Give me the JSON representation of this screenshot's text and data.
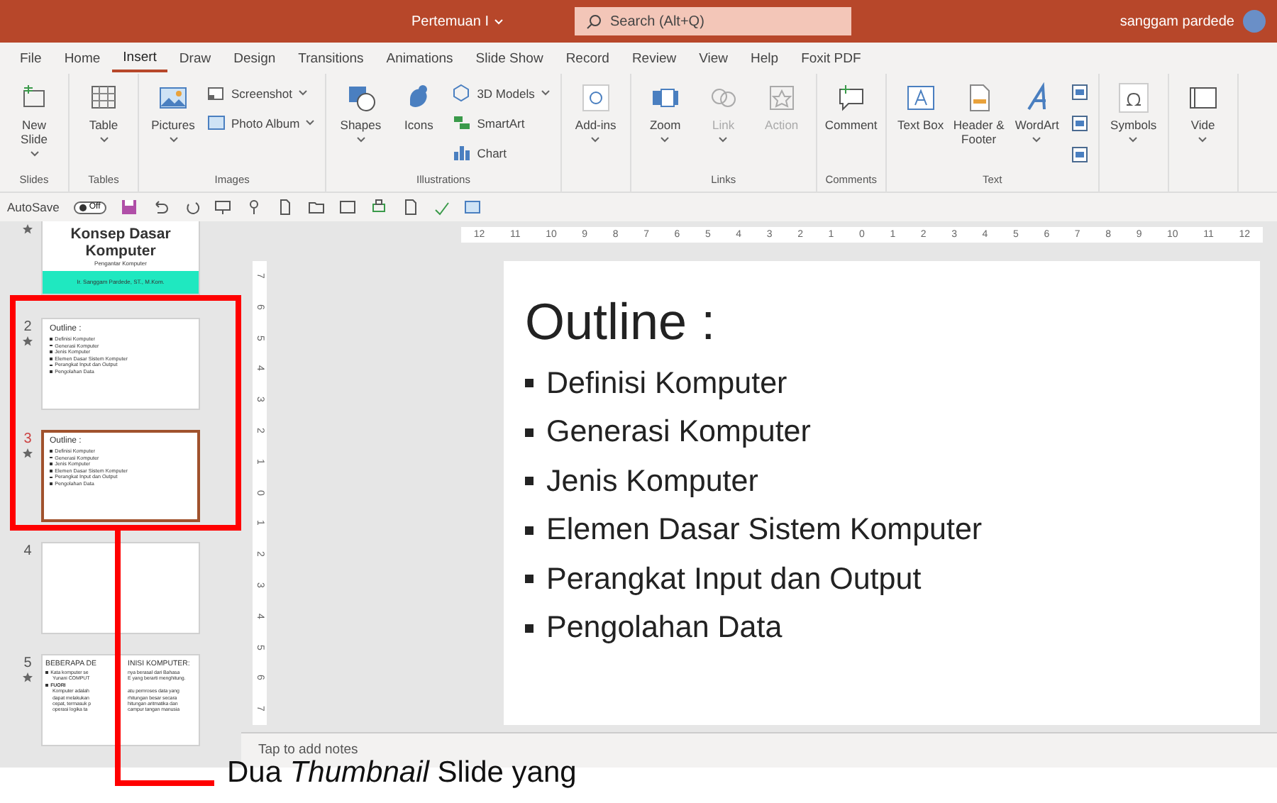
{
  "title_bar": {
    "document_title": "Pertemuan I",
    "search": {
      "placeholder": "Search (Alt+Q)"
    },
    "user": "sanggam pardede"
  },
  "menu_tabs": [
    {
      "label": "File",
      "selected": false
    },
    {
      "label": "Home",
      "selected": false
    },
    {
      "label": "Insert",
      "selected": true
    },
    {
      "label": "Draw",
      "selected": false
    },
    {
      "label": "Design",
      "selected": false
    },
    {
      "label": "Transitions",
      "selected": false
    },
    {
      "label": "Animations",
      "selected": false
    },
    {
      "label": "Slide Show",
      "selected": false
    },
    {
      "label": "Record",
      "selected": false
    },
    {
      "label": "Review",
      "selected": false
    },
    {
      "label": "View",
      "selected": false
    },
    {
      "label": "Help",
      "selected": false
    },
    {
      "label": "Foxit PDF",
      "selected": false
    }
  ],
  "ribbon": {
    "groups": [
      {
        "label": "Slides",
        "items": [
          {
            "kind": "large",
            "label": "New Slide",
            "dropdown": true,
            "disabled": false
          }
        ]
      },
      {
        "label": "Tables",
        "items": [
          {
            "kind": "large",
            "label": "Table",
            "dropdown": true,
            "disabled": false
          }
        ]
      },
      {
        "label": "Images",
        "items": [
          {
            "kind": "large",
            "label": "Pictures",
            "dropdown": true,
            "disabled": false
          },
          {
            "kind": "small",
            "label": "Screenshot",
            "dropdown": true,
            "disabled": false
          },
          {
            "kind": "small",
            "label": "Photo Album",
            "dropdown": true,
            "disabled": false
          }
        ]
      },
      {
        "label": "Illustrations",
        "items": [
          {
            "kind": "large",
            "label": "Shapes",
            "dropdown": true,
            "disabled": false
          },
          {
            "kind": "large",
            "label": "Icons",
            "dropdown": false,
            "disabled": false
          },
          {
            "kind": "small",
            "label": "3D Models",
            "dropdown": true,
            "disabled": false
          },
          {
            "kind": "small",
            "label": "SmartArt",
            "dropdown": false,
            "disabled": false
          },
          {
            "kind": "small",
            "label": "Chart",
            "dropdown": false,
            "disabled": false
          }
        ]
      },
      {
        "items": [
          {
            "kind": "large",
            "label": "Add-ins",
            "dropdown": true,
            "disabled": false
          }
        ]
      },
      {
        "label": "Links",
        "items": [
          {
            "kind": "large",
            "label": "Zoom",
            "dropdown": true,
            "disabled": false
          },
          {
            "kind": "large",
            "label": "Link",
            "dropdown": true,
            "disabled": true
          },
          {
            "kind": "large",
            "label": "Action",
            "dropdown": false,
            "disabled": true
          }
        ]
      },
      {
        "label": "Comments",
        "items": [
          {
            "kind": "large",
            "label": "Comment",
            "dropdown": false,
            "disabled": false
          }
        ]
      },
      {
        "label": "Text",
        "items": [
          {
            "kind": "large",
            "label": "Text Box",
            "dropdown": false,
            "disabled": false
          },
          {
            "kind": "large",
            "label": "Header & Footer",
            "dropdown": false,
            "disabled": false
          },
          {
            "kind": "large",
            "label": "WordArt",
            "dropdown": true,
            "disabled": false
          },
          {
            "kind": "icons",
            "dropdown": false,
            "disabled": false
          }
        ]
      },
      {
        "items": [
          {
            "kind": "large",
            "label": "Symbols",
            "dropdown": true,
            "disabled": false
          }
        ]
      },
      {
        "items": [
          {
            "kind": "large",
            "label": "Vide",
            "dropdown": true,
            "disabled": false
          }
        ]
      }
    ]
  },
  "quick_access": {
    "autosave_label": "AutoSave",
    "autosave": {
      "on": false,
      "label": "Off"
    }
  },
  "thumbnails": [
    {
      "kind": "title",
      "starred": true,
      "selected": false,
      "title": "Konsep Dasar Komputer",
      "subtitle": "Pengantar Komputer",
      "author": "Ir. Sanggam Pardede, ST., M.Kom."
    },
    {
      "number": "2",
      "kind": "outline",
      "starred": true,
      "selected": false,
      "title": "Outline :",
      "bullets": [
        "Definisi Komputer",
        "Generasi Komputer",
        "Jenis Komputer",
        "Elemen Dasar Sistem Komputer",
        "Perangkat Input dan Output",
        "Pengolahan Data"
      ]
    },
    {
      "number": "3",
      "kind": "outline",
      "starred": true,
      "selected": true,
      "title": "Outline :",
      "bullets": [
        "Definisi Komputer",
        "Generasi Komputer",
        "Jenis Komputer",
        "Elemen Dasar Sistem Komputer",
        "Perangkat Input dan Output",
        "Pengolahan Data"
      ]
    },
    {
      "number": "4",
      "kind": "blank",
      "starred": false,
      "selected": false
    },
    {
      "number": "5",
      "kind": "split",
      "starred": true,
      "selected": false,
      "title": [
        "BEBERAPA DE",
        "INISI KOMPUTER:"
      ],
      "lines": [
        {
          "bullet": true,
          "bold": false,
          "parts": [
            "Kata komputer se",
            "nya berasal dari Bahasa"
          ]
        },
        {
          "bullet": false,
          "bold": false,
          "parts": [
            "Yunani COMPUT",
            "E yang berarti menghitung."
          ]
        },
        {
          "bullet": true,
          "bold": true,
          "parts": [
            "FUORI"
          ]
        },
        {
          "bullet": false,
          "bold": false,
          "parts": [
            "Komputer adalah",
            "atu pemroses data yang"
          ]
        },
        {
          "bullet": false,
          "bold": false,
          "parts": [
            "dapat melakukan",
            "rhitungan besar secara"
          ]
        },
        {
          "bullet": false,
          "bold": false,
          "parts": [
            "cepat, termasuk p",
            "hitungan aritmatika dan"
          ]
        },
        {
          "bullet": false,
          "bold": false,
          "parts": [
            "operasi logika ta",
            "campur tangan manusia"
          ]
        }
      ]
    }
  ],
  "rulers": {
    "horizontal": [
      "12",
      "11",
      "10",
      "9",
      "8",
      "7",
      "6",
      "5",
      "4",
      "3",
      "2",
      "1",
      "0",
      "1",
      "2",
      "3",
      "4",
      "5",
      "6",
      "7",
      "8",
      "9",
      "10",
      "11",
      "12"
    ],
    "vertical": [
      "7",
      "6",
      "5",
      "4",
      "3",
      "2",
      "1",
      "0",
      "1",
      "2",
      "3",
      "4",
      "5",
      "6",
      "7"
    ]
  },
  "slide": {
    "title": "Outline :",
    "bullets": [
      "Definisi Komputer",
      "Generasi Komputer",
      "Jenis Komputer",
      "Elemen Dasar Sistem Komputer",
      "Perangkat Input dan Output",
      "Pengolahan Data"
    ]
  },
  "notes": {
    "placeholder": "Tap to add notes"
  },
  "annotation": {
    "caption": "Dua *Thumbnail* Slide yang"
  }
}
